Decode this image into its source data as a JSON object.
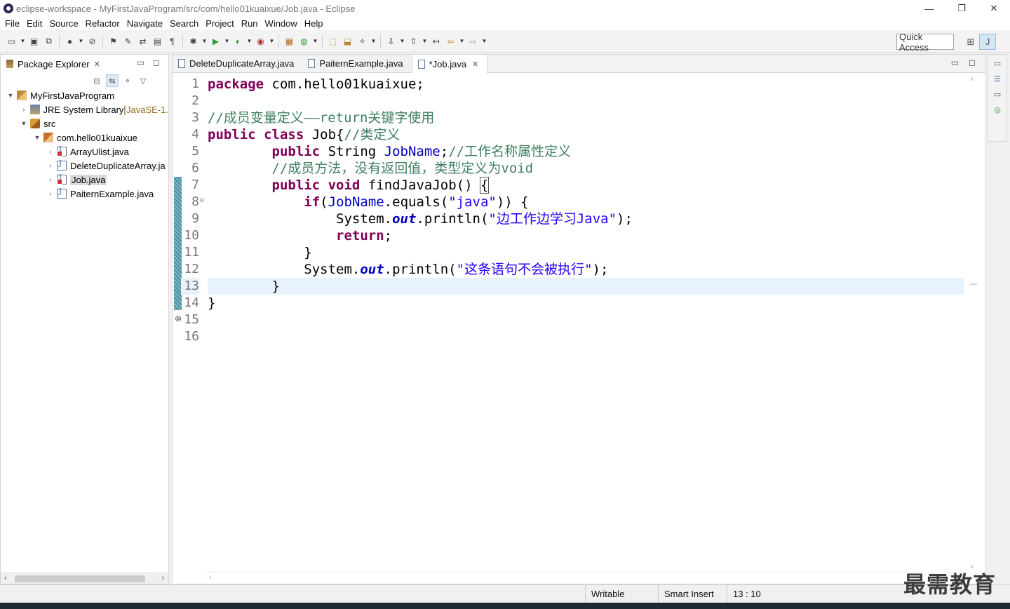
{
  "window": {
    "title": "eclipse-workspace - MyFirstJavaProgram/src/com/hello01kuaixue/Job.java - Eclipse",
    "controls": [
      "—",
      "❐",
      "✕"
    ]
  },
  "menu": [
    "File",
    "Edit",
    "Source",
    "Refactor",
    "Navigate",
    "Search",
    "Project",
    "Run",
    "Window",
    "Help"
  ],
  "toolbar": {
    "quick_access": "Quick Access"
  },
  "package_explorer": {
    "title": "Package Explorer",
    "tree": [
      {
        "label": "MyFirstJavaProgram",
        "suffix": "",
        "icon": "project-icon",
        "twisty": "▼",
        "depth": 0
      },
      {
        "label": "JRE System Library ",
        "suffix": "[JavaSE-1.",
        "icon": "library-icon",
        "twisty": "›",
        "depth": 1
      },
      {
        "label": "src",
        "suffix": "",
        "icon": "source-folder-icon",
        "twisty": "▼",
        "depth": 1
      },
      {
        "label": "com.hello01kuaixue",
        "suffix": "",
        "icon": "package-icon",
        "twisty": "▼",
        "depth": 2
      },
      {
        "label": "ArrayUlist.java",
        "suffix": "",
        "icon": "java-file-error-icon",
        "twisty": "›",
        "depth": 3
      },
      {
        "label": "DeleteDuplicateArray.ja",
        "suffix": "",
        "icon": "java-file-icon",
        "twisty": "›",
        "depth": 3
      },
      {
        "label": "Job.java",
        "suffix": "",
        "icon": "java-file-error-icon",
        "twisty": "›",
        "depth": 3,
        "selected": true
      },
      {
        "label": "PaiternExample.java",
        "suffix": "",
        "icon": "java-file-icon",
        "twisty": "›",
        "depth": 3
      }
    ]
  },
  "editor": {
    "tabs": [
      {
        "label": "DeleteDuplicateArray.java",
        "active": false
      },
      {
        "label": "PaiternExample.java",
        "active": false
      },
      {
        "label": "*Job.java",
        "active": true
      }
    ],
    "line_numbers": [
      "1",
      "2",
      "3",
      "4",
      "5",
      "6",
      "7",
      "8",
      "9",
      "10",
      "11",
      "12",
      "13",
      "14",
      "15",
      "16"
    ],
    "current_line": 13,
    "code": [
      [
        {
          "t": "package",
          "c": "kw"
        },
        {
          "t": " com.hello01kuaixue;",
          "c": ""
        }
      ],
      [],
      [
        {
          "t": "//成员变量定义——return关键字使用",
          "c": "cm"
        }
      ],
      [
        {
          "t": "public",
          "c": "kw"
        },
        {
          "t": " ",
          "c": ""
        },
        {
          "t": "class",
          "c": "kw"
        },
        {
          "t": " Job{",
          "c": ""
        },
        {
          "t": "//类定义",
          "c": "cm"
        }
      ],
      [
        {
          "t": "        ",
          "c": ""
        },
        {
          "t": "public",
          "c": "kw"
        },
        {
          "t": " String ",
          "c": ""
        },
        {
          "t": "JobName",
          "c": "fd"
        },
        {
          "t": ";",
          "c": ""
        },
        {
          "t": "//工作名称属性定义",
          "c": "cm"
        }
      ],
      [
        {
          "t": "        ",
          "c": ""
        },
        {
          "t": "//成员方法，没有返回值，类型定义为void",
          "c": "cm"
        }
      ],
      [
        {
          "t": "        ",
          "c": ""
        },
        {
          "t": "public",
          "c": "kw"
        },
        {
          "t": " ",
          "c": ""
        },
        {
          "t": "void",
          "c": "kw"
        },
        {
          "t": " findJavaJob() ",
          "c": ""
        },
        {
          "t": "{",
          "c": "brk"
        }
      ],
      [
        {
          "t": "            ",
          "c": ""
        },
        {
          "t": "if",
          "c": "kw"
        },
        {
          "t": "(",
          "c": ""
        },
        {
          "t": "JobName",
          "c": "fd"
        },
        {
          "t": ".equals(",
          "c": ""
        },
        {
          "t": "\"java\"",
          "c": "st"
        },
        {
          "t": ")) {",
          "c": ""
        }
      ],
      [
        {
          "t": "                System.",
          "c": ""
        },
        {
          "t": "out",
          "c": "sf"
        },
        {
          "t": ".println(",
          "c": ""
        },
        {
          "t": "\"边工作边学习Java\"",
          "c": "st"
        },
        {
          "t": ");",
          "c": ""
        }
      ],
      [
        {
          "t": "                ",
          "c": ""
        },
        {
          "t": "return",
          "c": "kw"
        },
        {
          "t": ";",
          "c": ""
        }
      ],
      [
        {
          "t": "            }",
          "c": ""
        }
      ],
      [
        {
          "t": "            System.",
          "c": ""
        },
        {
          "t": "out",
          "c": "sf"
        },
        {
          "t": ".println(",
          "c": ""
        },
        {
          "t": "\"这条语句不会被执行\"",
          "c": "st"
        },
        {
          "t": ");",
          "c": ""
        }
      ],
      [
        {
          "t": "        }",
          "c": ""
        }
      ],
      [
        {
          "t": "}",
          "c": ""
        }
      ],
      [],
      []
    ]
  },
  "status": {
    "writable": "Writable",
    "insert_mode": "Smart Insert",
    "position": "13 : 10"
  },
  "watermark": "最需教育"
}
